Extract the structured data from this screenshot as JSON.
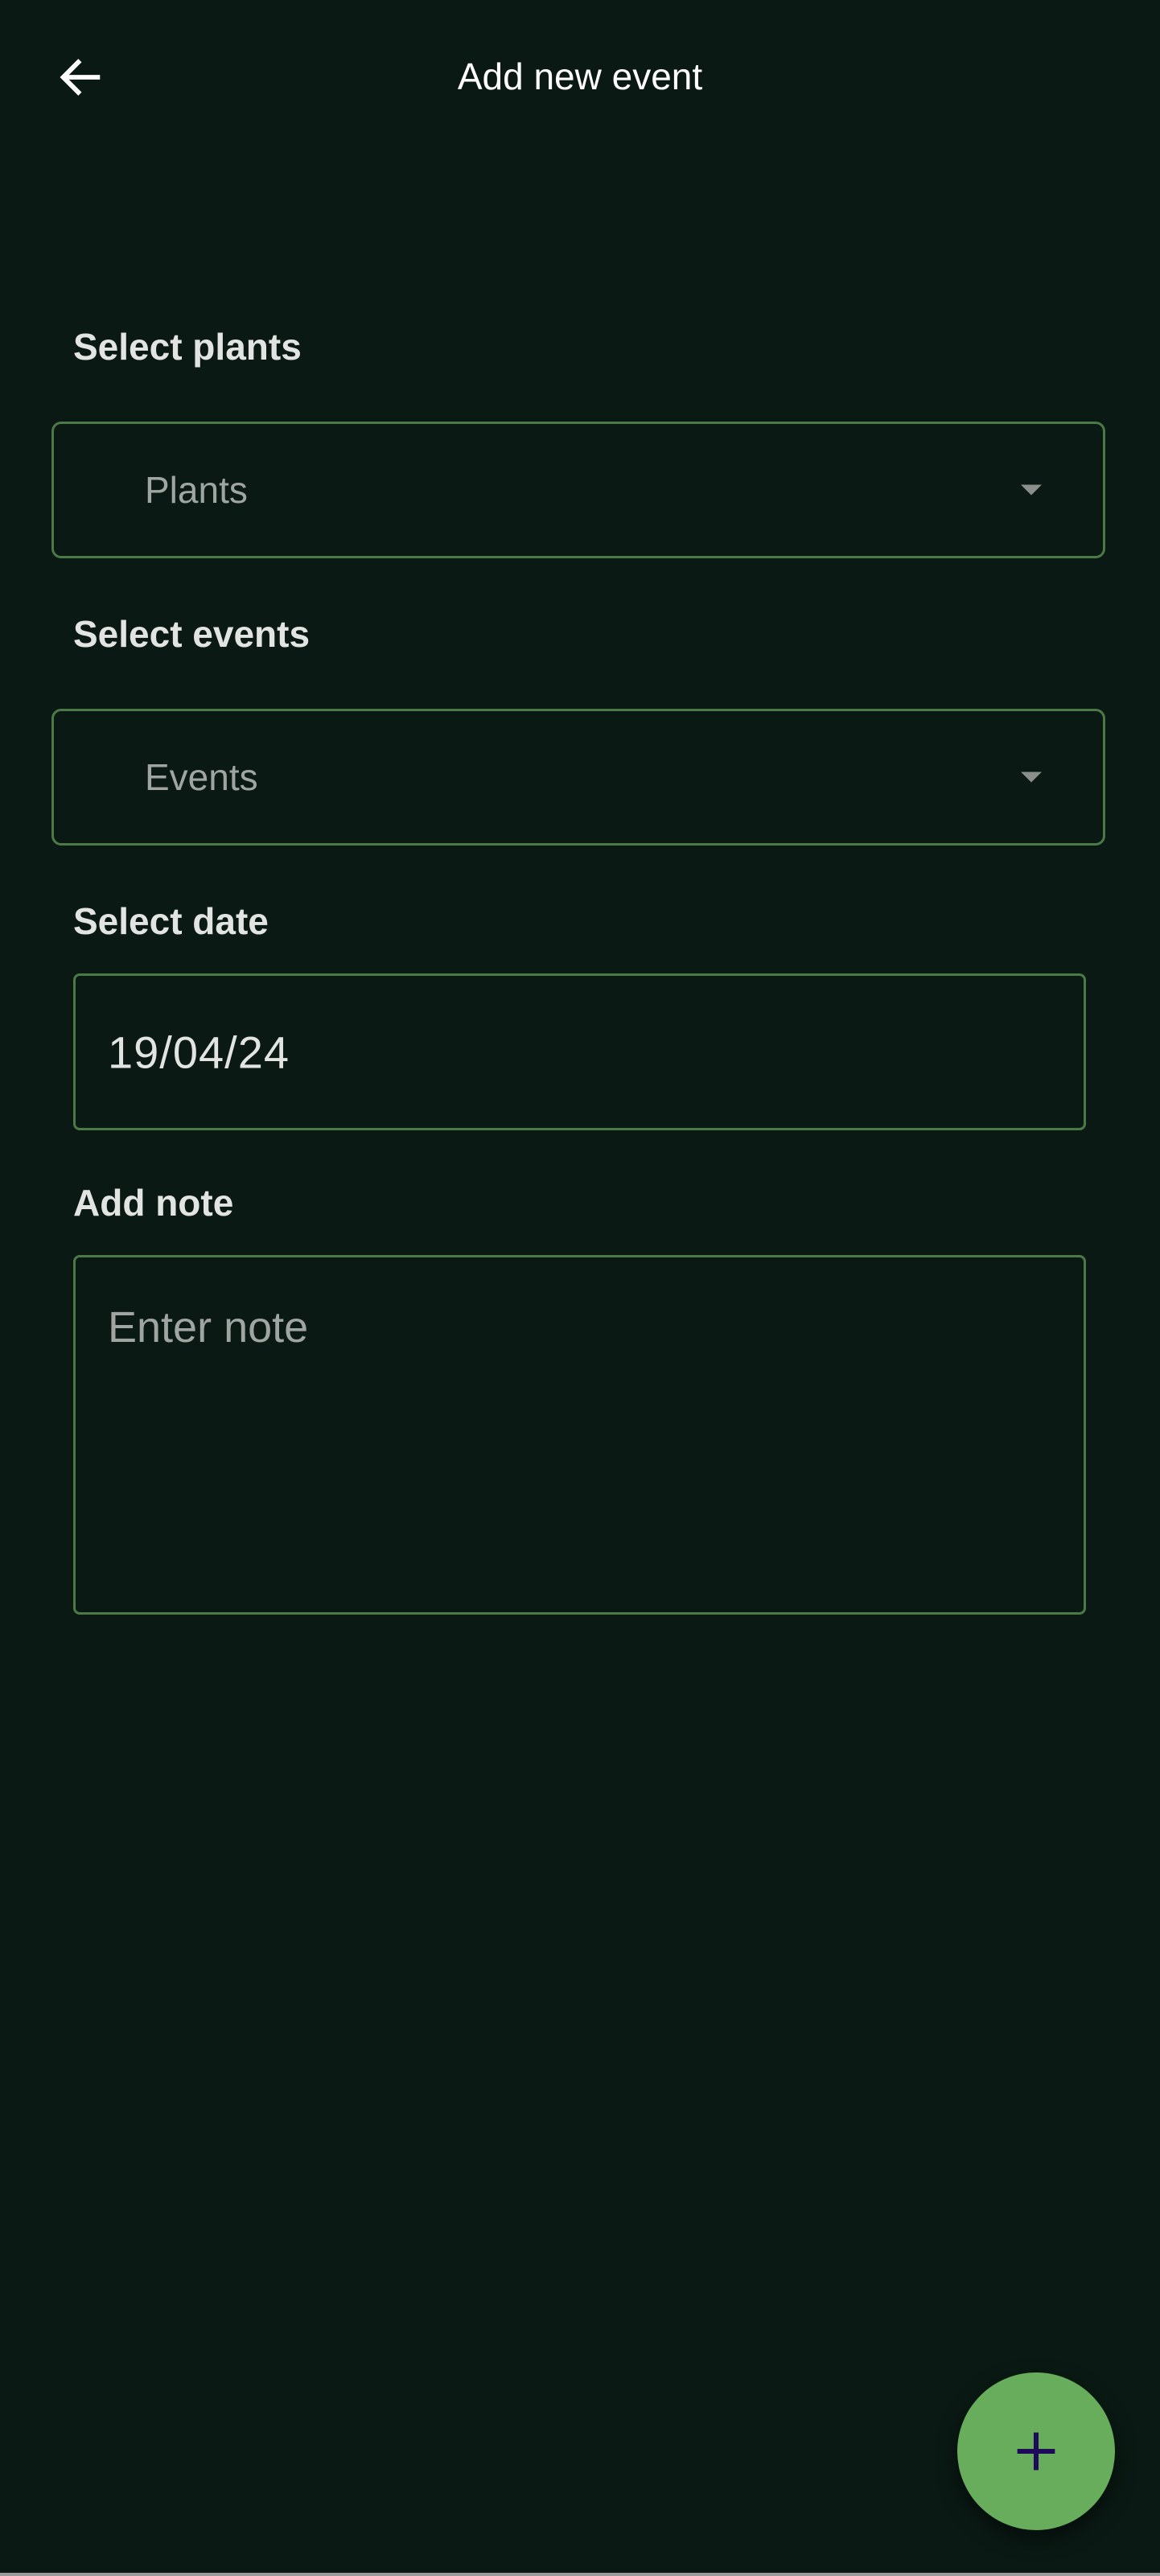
{
  "header": {
    "title": "Add new event",
    "back_icon": "arrow-left-icon"
  },
  "form": {
    "plants": {
      "label": "Select plants",
      "placeholder": "Plants"
    },
    "events": {
      "label": "Select events",
      "placeholder": "Events"
    },
    "date": {
      "label": "Select date",
      "value": "19/04/24"
    },
    "note": {
      "label": "Add note",
      "placeholder": "Enter note",
      "value": ""
    }
  },
  "fab": {
    "icon": "plus-icon"
  },
  "colors": {
    "background": "#0a1913",
    "accent": "#67ad5b",
    "border": "#4c7a46",
    "fab_icon": "#1e0a5a"
  }
}
